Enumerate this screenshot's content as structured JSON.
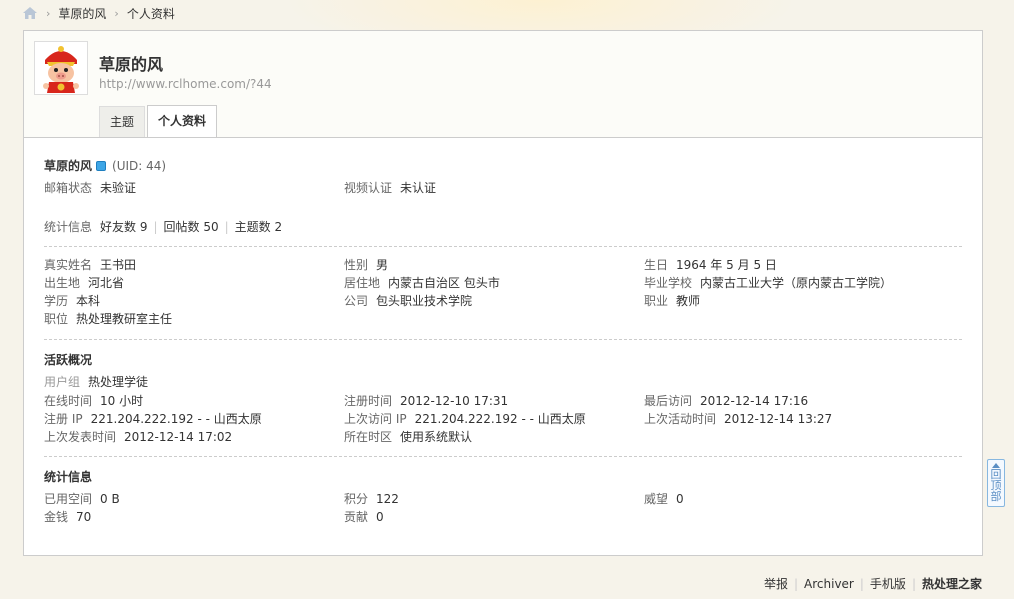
{
  "breadcrumb": {
    "user": "草原的风",
    "page": "个人资料",
    "sep": "›"
  },
  "header": {
    "username": "草原的风",
    "url": "http://www.rclhome.com/?44",
    "tabs": [
      {
        "label": "主题"
      },
      {
        "label": "个人资料"
      }
    ]
  },
  "profile": {
    "name": "草原的风",
    "uid": "(UID: 44)",
    "email_label": "邮箱状态",
    "email_value": "未验证",
    "video_label": "视频认证",
    "video_value": "未认证",
    "stats_label": "统计信息",
    "friends": "好友数 9",
    "replies": "回帖数 50",
    "threads": "主题数 2"
  },
  "details": {
    "realname_label": "真实姓名",
    "realname": "王书田",
    "gender_label": "性别",
    "gender": "男",
    "birthday_label": "生日",
    "birthday": "1964 年 5 月 5 日",
    "birthplace_label": "出生地",
    "birthplace": "河北省",
    "residence_label": "居住地",
    "residence": "内蒙古自治区 包头市",
    "school_label": "毕业学校",
    "school": "内蒙古工业大学（原内蒙古工学院）",
    "education_label": "学历",
    "education": "本科",
    "company_label": "公司",
    "company": "包头职业技术学院",
    "occupation_label": "职业",
    "occupation": "教师",
    "position_label": "职位",
    "position": "热处理教研室主任"
  },
  "activity": {
    "title": "活跃概况",
    "group_label": "用户组",
    "group": "热处理学徒",
    "online_label": "在线时间",
    "online": "10 小时",
    "regtime_label": "注册时间",
    "regtime": "2012-12-10 17:31",
    "lastvisit_label": "最后访问",
    "lastvisit": "2012-12-14 17:16",
    "regip_label": "注册 IP",
    "regip": "221.204.222.192 - - 山西太原",
    "lastip_label": "上次访问 IP",
    "lastip": "221.204.222.192 - - 山西太原",
    "lastactive_label": "上次活动时间",
    "lastactive": "2012-12-14 13:27",
    "lastpost_label": "上次发表时间",
    "lastpost": "2012-12-14 17:02",
    "timezone_label": "所在时区",
    "timezone": "使用系统默认"
  },
  "statistics": {
    "title": "统计信息",
    "space_label": "已用空间",
    "space": "0 B",
    "credits_label": "积分",
    "credits": "122",
    "prestige_label": "威望",
    "prestige": "0",
    "money_label": "金钱",
    "money": "70",
    "contribution_label": "贡献",
    "contribution": "0"
  },
  "backtop": {
    "c1": "回",
    "c2": "顶",
    "c3": "部"
  },
  "footer": {
    "report": "举报",
    "archiver": "Archiver",
    "mobile": "手机版",
    "brand": "热处理之家"
  },
  "icons": {
    "home": "home-icon",
    "verified": "verified-icon",
    "avatar": "pig-avatar"
  },
  "colors": {
    "background": "#f6f3ea",
    "border": "#cccccc",
    "accent": "#3ea6e6"
  }
}
